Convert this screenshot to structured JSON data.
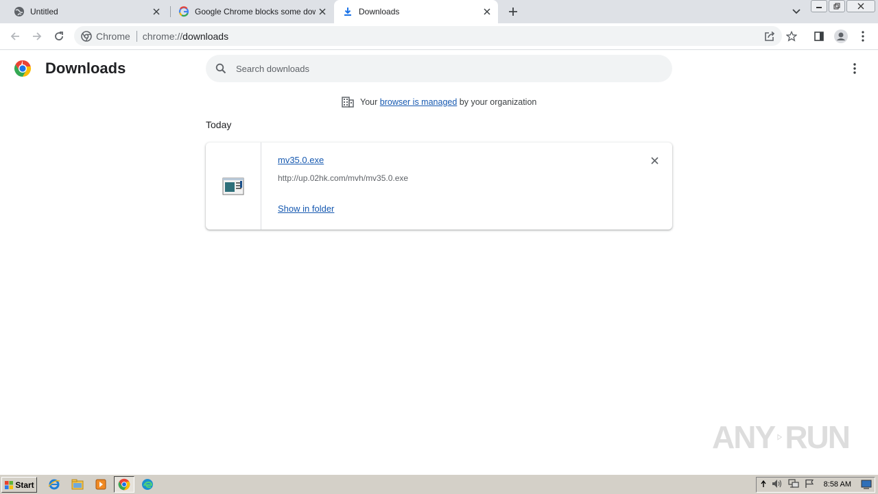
{
  "tabs": [
    {
      "title": "Untitled",
      "favicon": "globe-icon",
      "active": false
    },
    {
      "title": "Google Chrome blocks some downloads",
      "favicon": "google-g-icon",
      "active": false
    },
    {
      "title": "Downloads",
      "favicon": "download-icon",
      "active": true
    }
  ],
  "omnibox": {
    "chip": "Chrome",
    "url_scheme": "chrome://",
    "url_host": "downloads"
  },
  "page": {
    "title": "Downloads",
    "search_placeholder": "Search downloads",
    "managed": {
      "prefix": "Your",
      "link": "browser is managed",
      "suffix": "by your organization"
    },
    "section": "Today"
  },
  "download": {
    "filename": "mv35.0.exe",
    "url": "http://up.02hk.com/mvh/mv35.0.exe",
    "action": "Show in folder"
  },
  "watermark": {
    "left": "ANY",
    "right": "RUN"
  },
  "taskbar": {
    "start_label": "Start",
    "clock": "8:58 AM"
  },
  "colors": {
    "tabstrip": "#dee1e6",
    "link": "#1558b0",
    "omnibox": "#f1f3f4"
  }
}
